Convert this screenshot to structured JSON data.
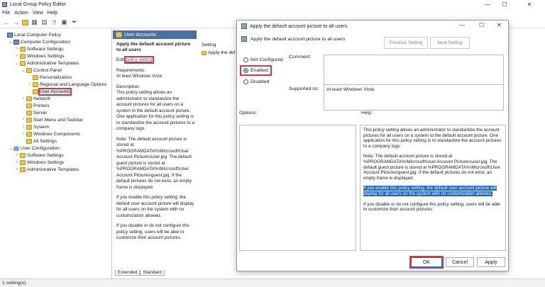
{
  "window": {
    "title": "Local Group Policy Editor",
    "controls": [
      "—",
      "☐",
      "✕"
    ]
  },
  "menu": [
    "File",
    "Action",
    "View",
    "Help"
  ],
  "tree": [
    {
      "label": "Local Computer Policy",
      "level": 0,
      "chev": "",
      "icon": "pc"
    },
    {
      "label": "Computer Configuration",
      "level": 1,
      "chev": "⌄",
      "icon": "pc"
    },
    {
      "label": "Software Settings",
      "level": 2,
      "chev": "›",
      "icon": "folder"
    },
    {
      "label": "Windows Settings",
      "level": 2,
      "chev": "›",
      "icon": "folder"
    },
    {
      "label": "Administrative Templates",
      "level": 2,
      "chev": "⌄",
      "icon": "folder"
    },
    {
      "label": "Control Panel",
      "level": 3,
      "chev": "⌄",
      "icon": "folder"
    },
    {
      "label": "Personalization",
      "level": 4,
      "chev": "",
      "icon": "folder"
    },
    {
      "label": "Regional and Language Options",
      "level": 4,
      "chev": "›",
      "icon": "folder"
    },
    {
      "label": "User Accounts",
      "level": 4,
      "chev": "",
      "icon": "folder",
      "selected": true
    },
    {
      "label": "Network",
      "level": 3,
      "chev": "›",
      "icon": "folder"
    },
    {
      "label": "Printers",
      "level": 3,
      "chev": "",
      "icon": "folder"
    },
    {
      "label": "Server",
      "level": 3,
      "chev": "",
      "icon": "folder"
    },
    {
      "label": "Start Menu and Taskbar",
      "level": 3,
      "chev": "›",
      "icon": "folder"
    },
    {
      "label": "System",
      "level": 3,
      "chev": "›",
      "icon": "folder"
    },
    {
      "label": "Windows Components",
      "level": 3,
      "chev": "›",
      "icon": "folder"
    },
    {
      "label": "All Settings",
      "level": 3,
      "chev": "",
      "icon": "folder"
    },
    {
      "label": "User Configuration",
      "level": 1,
      "chev": "⌄",
      "icon": "user"
    },
    {
      "label": "Software Settings",
      "level": 2,
      "chev": "›",
      "icon": "folder"
    },
    {
      "label": "Windows Settings",
      "level": 2,
      "chev": "›",
      "icon": "folder"
    },
    {
      "label": "Administrative Templates",
      "level": 2,
      "chev": "›",
      "icon": "folder"
    }
  ],
  "pane": {
    "header": "User Accounts",
    "title": "Apply the default account picture to all users",
    "edit_prefix": "Edit ",
    "edit_link": "policy setting",
    "req_label": "Requirements:",
    "req_value": "At least Windows Vista",
    "desc_label": "Description:",
    "desc": [
      "This policy setting allows an administrator to standardize the account pictures for all users on a system to the default account picture. One application for this policy setting is to standardize the account pictures to a company logo.",
      "Note: The default account picture is stored at %PROGRAMDATA%\\Microsoft\\User Account Pictures\\user.jpg. The default guest picture is stored at %PROGRAMDATA%\\Microsoft\\User Account Pictures\\guest.jpg. If the default pictures do not exist, an empty frame is displayed.",
      "If you enable this policy setting, the default user account picture will display for all users on the system with no customization allowed.",
      "If you disable or do not configure this policy setting, users will be able to customize their account pictures."
    ],
    "setting_col": "Setting",
    "setting_row": "Apply the def"
  },
  "tabs": [
    "Extended",
    "Standard"
  ],
  "status": "1 setting(s)",
  "dialog": {
    "title": "Apply the default account picture to all users",
    "subtitle": "Apply the default account picture to all users",
    "prev": "Previous Setting",
    "next": "Next Setting",
    "radios": [
      "Not Configured",
      "Enabled",
      "Disabled"
    ],
    "comment_label": "Comment:",
    "supported_label": "Supported on:",
    "supported_value": "At least Windows Vista",
    "options_label": "Options:",
    "help_label": "Help:",
    "help": [
      "This policy setting allows an administrator to standardize the account pictures for all users on a system to the default account picture. One application for this policy setting is to standardize the account pictures to a company logo.",
      "Note: The default account picture is stored at %PROGRAMDATA%\\Microsoft\\User Account Pictures\\user.jpg. The default guest picture is stored at %PROGRAMDATA%\\Microsoft\\User Account Pictures\\guest.jpg. If the default pictures do not exist, an empty frame is displayed.",
      "If you enable this policy setting, the default user account picture will display for all users on the system with no customization allowed.",
      "If you disable or do not configure this policy setting, users will be able to customize their account pictures."
    ],
    "ok": "OK",
    "cancel": "Cancel",
    "apply": "Apply"
  }
}
